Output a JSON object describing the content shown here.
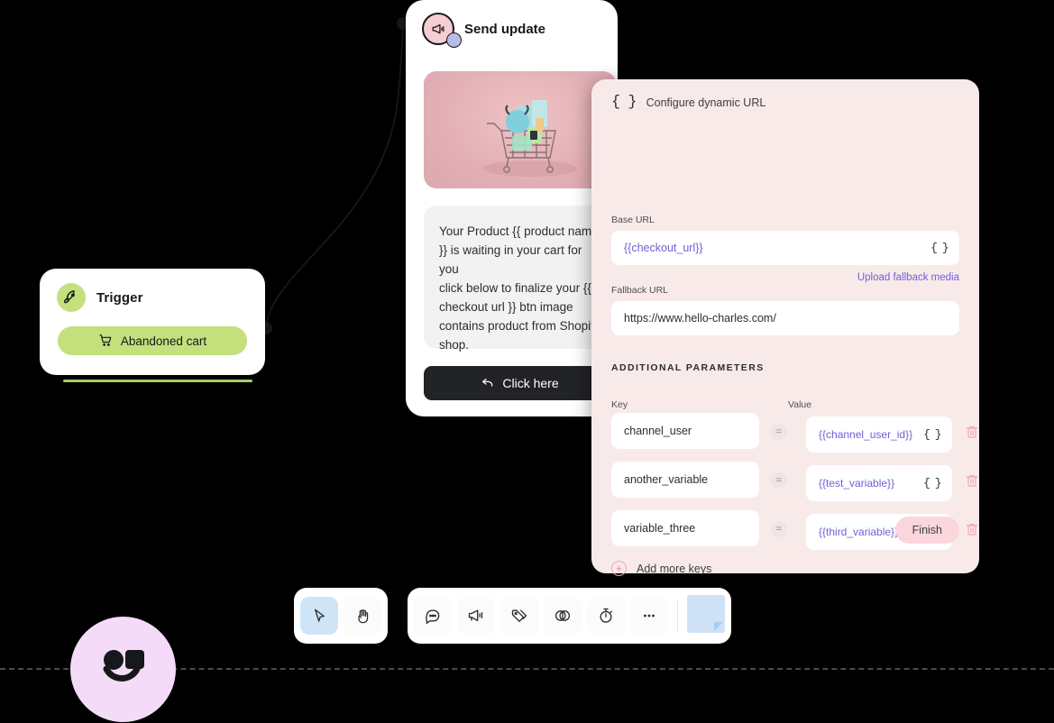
{
  "canvas": {
    "background_color": "#000000",
    "baseline_style": "dashed"
  },
  "trigger_node": {
    "icon": "rocket-icon",
    "title": "Trigger",
    "accent_color": "#c3e07d",
    "pill": {
      "icon": "shopping-cart-icon",
      "label": "Abandoned cart"
    }
  },
  "send_update_node": {
    "icon": "megaphone-icon",
    "title": "Send update",
    "badge_color": "#b9bce3",
    "image_alt": "shopping-cart-product-photo",
    "message": "Your Product {{ product name }} is waiting in your cart for you\nclick below to finalize your {{ checkout url }} btn image contains product from Shopify shop.",
    "button": {
      "icon": "reply-arrow-icon",
      "label": "Click here"
    }
  },
  "panel": {
    "icon": "curly-braces-icon",
    "title": "Configure dynamic URL",
    "base_url": {
      "label": "Base URL",
      "value": "{{checkout_url}}",
      "variable_color": "#6b62d6",
      "trailing_icon": "curly-braces-icon"
    },
    "fallback_url": {
      "label": "Fallback URL",
      "value": "https://www.hello-charles.com/",
      "upload_link": "Upload fallback media"
    },
    "additional_parameters": {
      "section_title": "ADDITIONAL PARAMETERS",
      "key_header": "Key",
      "value_header": "Value",
      "operator": "=",
      "rows": [
        {
          "key": "channel_user",
          "value": "{{channel_user_id}}",
          "trailing_icon": "curly-braces-icon",
          "delete_icon": "trash-icon"
        },
        {
          "key": "another_variable",
          "value": "{{test_variable}}",
          "trailing_icon": "curly-braces-icon",
          "delete_icon": "trash-icon"
        },
        {
          "key": "variable_three",
          "value": "{{third_variable}}",
          "trailing_icon": "curly-braces-icon",
          "delete_icon": "trash-icon"
        }
      ],
      "add_more": {
        "icon": "plus-circle-icon",
        "label": "Add more keys"
      }
    },
    "finish_label": "Finish",
    "finish_color": "#fbd6dc",
    "background_color": "#f9eaea"
  },
  "toolbar_left": {
    "items": [
      {
        "icon": "cursor-arrow-icon",
        "active": true
      },
      {
        "icon": "hand-icon",
        "active": false
      }
    ]
  },
  "toolbar_right": {
    "items": [
      {
        "icon": "chat-bubble-icon"
      },
      {
        "icon": "megaphone-icon"
      },
      {
        "icon": "tag-icon"
      },
      {
        "icon": "ab-split-icon"
      },
      {
        "icon": "timer-icon"
      },
      {
        "icon": "ellipsis-icon"
      }
    ],
    "note": {
      "icon": "sticky-note-icon",
      "color": "#cfe2f5"
    }
  },
  "logo": {
    "name": "charles-logo",
    "background_color": "#f4dcf8"
  }
}
